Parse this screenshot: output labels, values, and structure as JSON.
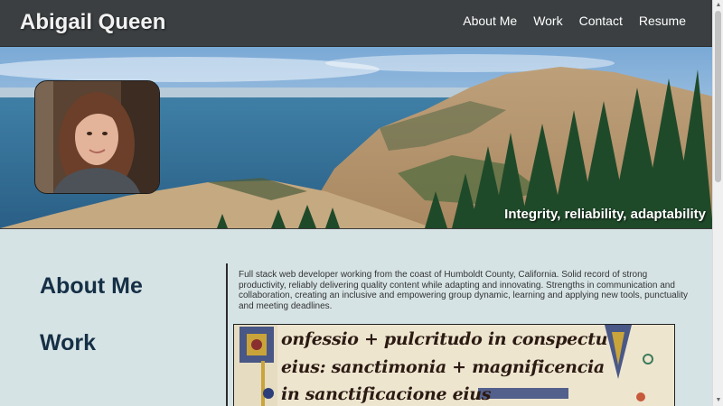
{
  "header": {
    "site_title": "Abigail Queen",
    "nav": [
      {
        "label": "About Me"
      },
      {
        "label": "Work"
      },
      {
        "label": "Contact"
      },
      {
        "label": "Resume"
      }
    ]
  },
  "hero": {
    "tagline": "Integrity, reliability, adaptability"
  },
  "sidebar": {
    "items": [
      {
        "label": "About Me"
      },
      {
        "label": "Work"
      }
    ]
  },
  "about": {
    "text": "Full stack web developer working from the coast of Humboldt County, California. Solid record of strong productivity, reliably delivering quality content while adapting and innovating. Strengths in communication and collaboration, creating an inclusive and empowering group dynamic, learning and applying new tools, punctuality and meeting deadlines."
  },
  "work_image": {
    "lines": [
      "onfessio + pulcritudo in conspectu",
      "eius: sanctimonia + magnificencia",
      "in sanctificacione eius"
    ]
  },
  "colors": {
    "header_bg": "#3b3f41",
    "page_bg": "#d6e3e5",
    "heading": "#152f45"
  }
}
